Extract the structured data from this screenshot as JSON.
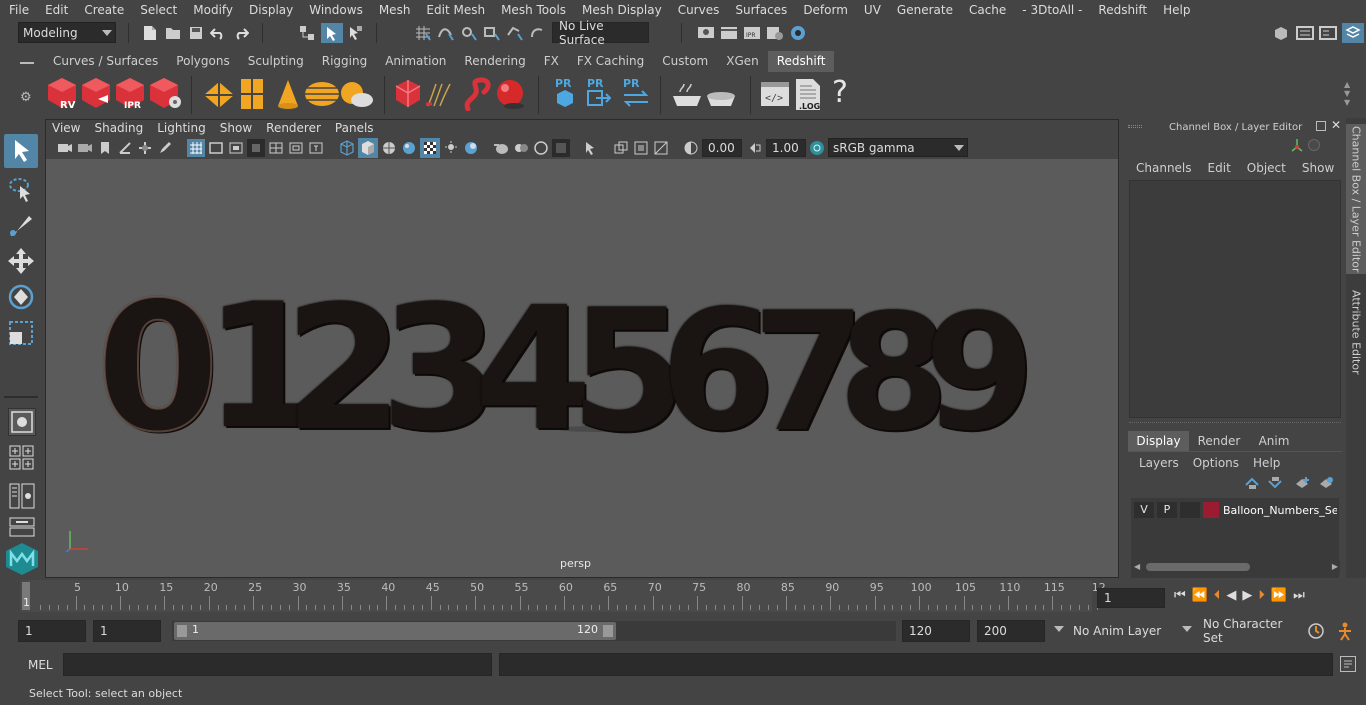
{
  "menu": [
    "File",
    "Edit",
    "Create",
    "Select",
    "Modify",
    "Display",
    "Windows",
    "Mesh",
    "Edit Mesh",
    "Mesh Tools",
    "Mesh Display",
    "Curves",
    "Surfaces",
    "Deform",
    "UV",
    "Generate",
    "Cache",
    "- 3DtoAll -",
    "Redshift",
    "Help"
  ],
  "status": {
    "mode": "Modeling",
    "live_surface": "No Live Surface"
  },
  "shelf_tabs": [
    "Curves / Surfaces",
    "Polygons",
    "Sculpting",
    "Rigging",
    "Animation",
    "Rendering",
    "FX",
    "FX Caching",
    "Custom",
    "XGen",
    "Redshift"
  ],
  "shelf_active": "Redshift",
  "shelf_labels": {
    "rv": "RV",
    "ipr": "IPR",
    "pr": "PR",
    "log": ".LOG",
    "help": "?"
  },
  "panel_menu": [
    "View",
    "Shading",
    "Lighting",
    "Show",
    "Renderer",
    "Panels"
  ],
  "panel_toolbar": {
    "exposure": "0.00",
    "gamma": "1.00",
    "color_space": "sRGB gamma"
  },
  "viewport": {
    "camera_label": "persp",
    "digits": [
      "0",
      "1",
      "2",
      "3",
      "4",
      "5",
      "6",
      "7",
      "8",
      "9"
    ]
  },
  "channel_box": {
    "title": "Channel Box / Layer Editor",
    "menu": [
      "Channels",
      "Edit",
      "Object",
      "Show"
    ],
    "tabs": [
      "Display",
      "Render",
      "Anim"
    ],
    "active_tab": "Display",
    "layer_menu": [
      "Layers",
      "Options",
      "Help"
    ],
    "layer": {
      "v": "V",
      "p": "P",
      "name": "Balloon_Numbers_Set_",
      "color": "#9b1b30"
    }
  },
  "side_tabs": [
    "Channel Box / Layer Editor",
    "Attribute Editor"
  ],
  "timeline": {
    "ticks": [
      "5",
      "10",
      "15",
      "20",
      "25",
      "30",
      "35",
      "40",
      "45",
      "50",
      "55",
      "60",
      "65",
      "70",
      "75",
      "80",
      "85",
      "90",
      "95",
      "100",
      "105",
      "110",
      "115",
      "12"
    ],
    "start_label": "1",
    "current_frame": "1"
  },
  "range": {
    "start": "1",
    "playback_start": "1",
    "slider_start": "1",
    "slider_end": "120",
    "playback_end": "120",
    "end": "200",
    "anim_layer": "No Anim Layer",
    "character_set": "No Character Set"
  },
  "command": {
    "lang": "MEL"
  },
  "help_line": "Select Tool: select an object",
  "colors": {
    "accent": "#5285a6",
    "viewport_bg": "#5b5b5b",
    "layer": "#9b1b30"
  }
}
